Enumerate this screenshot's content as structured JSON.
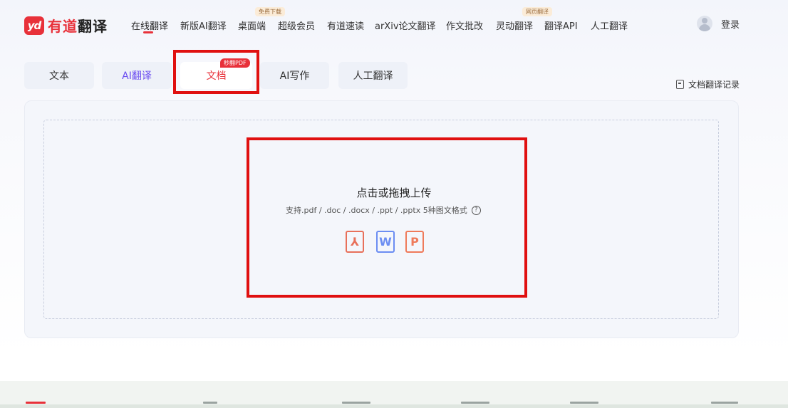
{
  "header": {
    "logo": {
      "badge": "yd",
      "brand_red": "有道",
      "brand_dark": "翻译"
    },
    "nav": [
      {
        "label": "在线翻译"
      },
      {
        "label": "新版AI翻译"
      },
      {
        "label": "桌面端",
        "tag": "免费下载"
      },
      {
        "label": "超级会员"
      },
      {
        "label": "有道速读"
      },
      {
        "label": "arXiv论文翻译"
      },
      {
        "label": "作文批改"
      },
      {
        "label": "灵动翻译",
        "tag": "网页翻译"
      },
      {
        "label": "翻译API"
      },
      {
        "label": "人工翻译"
      }
    ],
    "login_label": "登录"
  },
  "tabs": [
    {
      "label": "文本"
    },
    {
      "label": "AI翻译"
    },
    {
      "label": "文档",
      "tag": "秒翻PDF"
    },
    {
      "label": "AI写作"
    },
    {
      "label": "人工翻译"
    }
  ],
  "history_label": "文档翻译记录",
  "upload": {
    "title": "点击或拖拽上传",
    "description": "支持.pdf / .doc / .docx / .ppt / .pptx 5种图文格式",
    "help_glyph": "?",
    "file_types": [
      {
        "icon": "pdf-file-icon",
        "glyph": "⅄"
      },
      {
        "icon": "word-file-icon",
        "glyph": "W"
      },
      {
        "icon": "ppt-file-icon",
        "glyph": "P"
      }
    ]
  },
  "colors": {
    "accent": "#e8313a",
    "ai_purple": "#6a4cf0",
    "annotation_red": "#e01010"
  }
}
